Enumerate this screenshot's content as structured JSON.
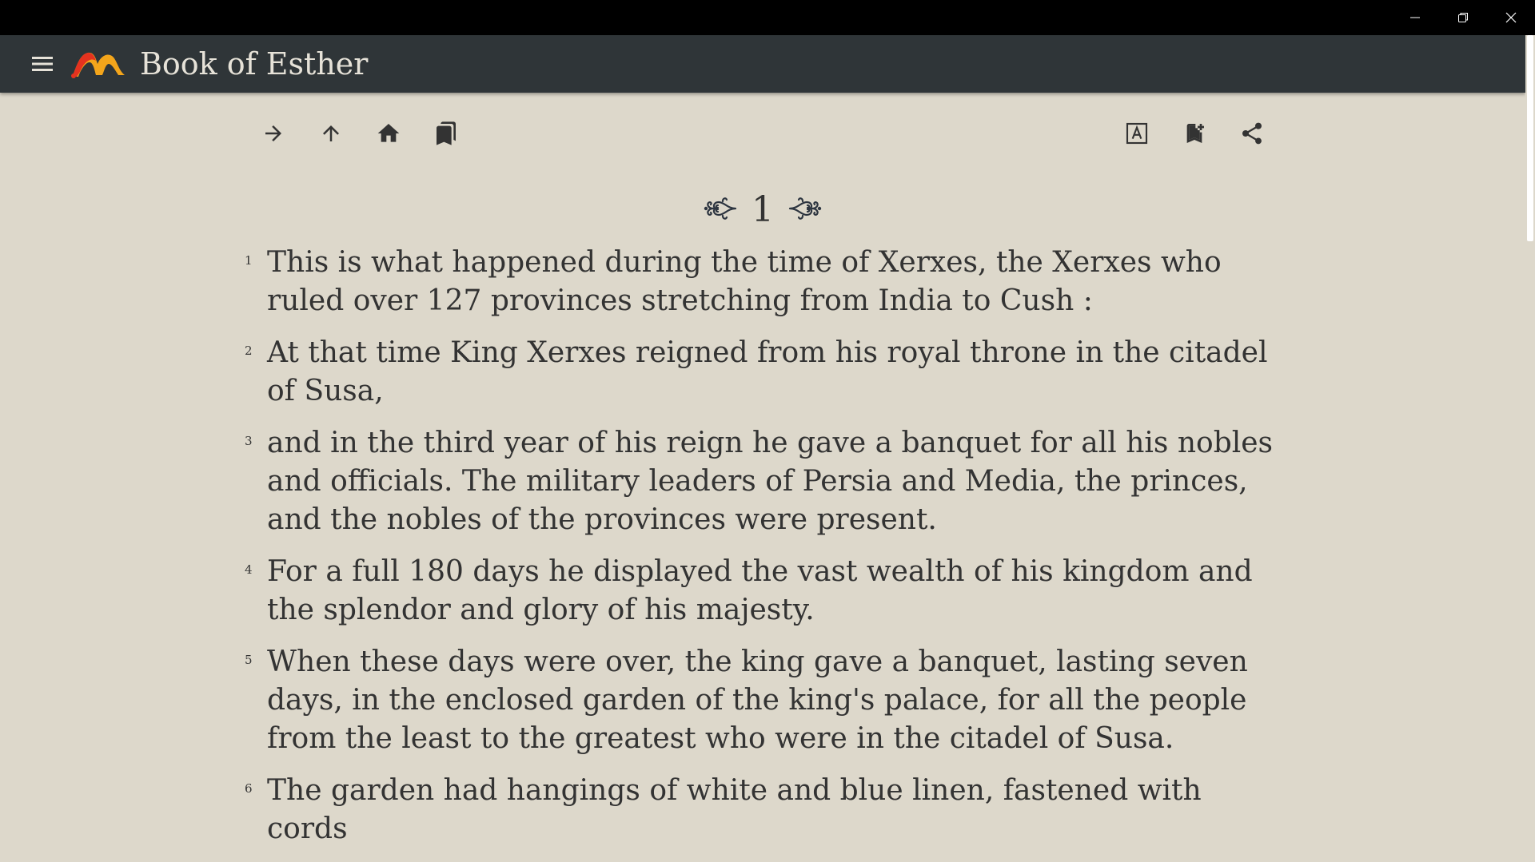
{
  "window": {
    "controls": [
      {
        "name": "minimize-icon"
      },
      {
        "name": "restore-icon"
      },
      {
        "name": "close-icon"
      }
    ]
  },
  "appbar": {
    "title": "Book of Esther",
    "menu_icon": "hamburger-menu-icon",
    "logo_icon": "app-logo-icon"
  },
  "toolbar": {
    "left": [
      {
        "icon": "arrow-right-icon"
      },
      {
        "icon": "arrow-up-icon"
      },
      {
        "icon": "home-icon"
      },
      {
        "icon": "bookmarks-icon"
      }
    ],
    "right": [
      {
        "icon": "font-size-icon"
      },
      {
        "icon": "add-bookmark-icon"
      },
      {
        "icon": "share-icon"
      }
    ]
  },
  "chapter": {
    "number": "1",
    "ornament": "flourish-ornament-icon"
  },
  "verses": [
    {
      "num": "1",
      "text": "This is what happened during the time of Xerxes, the Xerxes who ruled over 127 provinces stretching from India to Cush :"
    },
    {
      "num": "2",
      "text": "At that time King Xerxes reigned from his royal throne in the citadel of Susa,"
    },
    {
      "num": "3",
      "text": "and in the third year of his reign he gave a banquet for all his nobles and officials. The military leaders of Persia and Media, the princes, and the nobles of the provinces were present."
    },
    {
      "num": "4",
      "text": "For a full 180 days he displayed the vast wealth of his kingdom and the splendor and glory of his majesty."
    },
    {
      "num": "5",
      "text": "When these days were over, the king gave a banquet, lasting seven days, in the enclosed garden of the king's palace, for all the people from the least to the greatest who were in the citadel of Susa."
    },
    {
      "num": "6",
      "text": "The garden had hangings of white and blue linen, fastened with cords"
    }
  ],
  "colors": {
    "background": "#ddd8cb",
    "appbar": "#2f3538",
    "text": "#333333",
    "logo_red": "#e5321f",
    "logo_orange": "#f3a51b"
  }
}
